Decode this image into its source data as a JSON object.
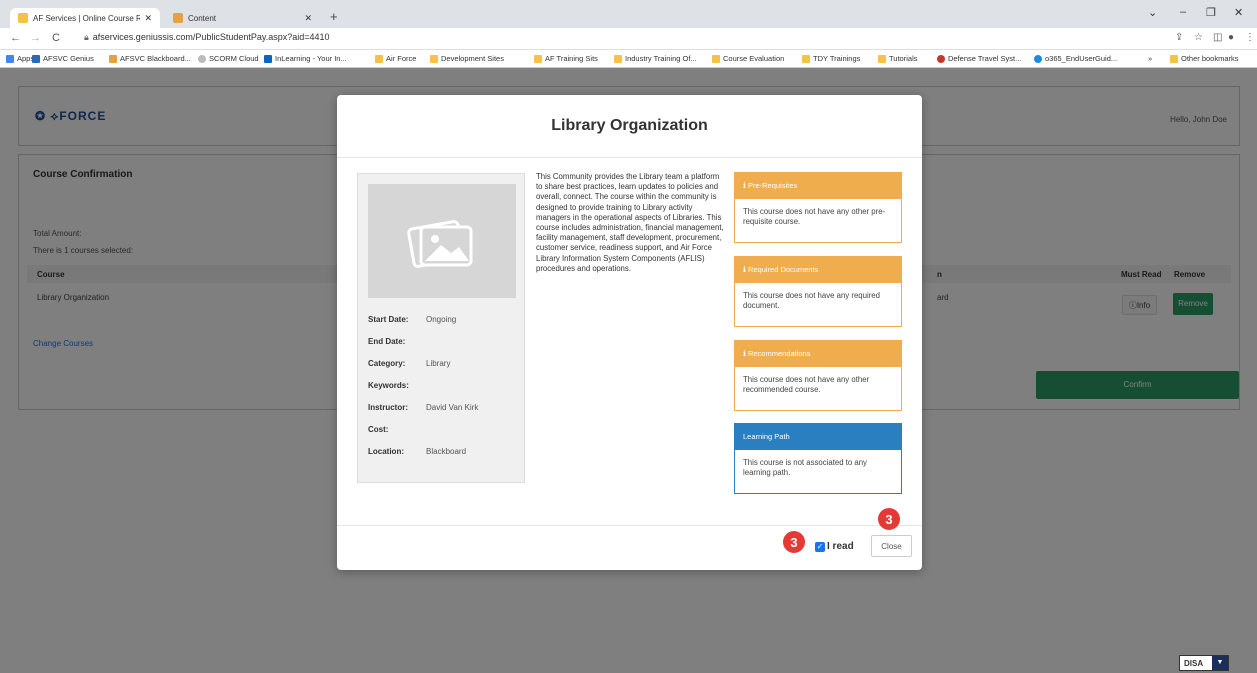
{
  "browser": {
    "tabs": [
      {
        "title": "AF Services | Online Course Regi",
        "close": "✕"
      },
      {
        "title": "Content",
        "close": "✕"
      }
    ],
    "url": "afservices.geniussis.com/PublicStudentPay.aspx?aid=4410",
    "bookmarks": [
      "Apps",
      "AFSVC Genius",
      "AFSVC Blackboard...",
      "SCORM Cloud",
      "InLearning - Your In...",
      "Air Force",
      "Development Sites",
      "AF Training Sits",
      "Industry Training Of...",
      "Course Evaluation",
      "TDY Trainings",
      "Tutorials",
      "Defense Travel Syst...",
      "o365_EndUserGuid...",
      "»",
      "Other bookmarks"
    ]
  },
  "page": {
    "logo": "FORCE",
    "greeting": "Hello, John Doe",
    "section_title": "Course Confirmation",
    "total_amount_label": "Total Amount:",
    "selected_text": "There is 1 courses selected:",
    "table_headers": {
      "course": "Course",
      "n": "n",
      "must_read": "Must Read",
      "remove": "Remove"
    },
    "row": {
      "course": "Library Organization",
      "partial": "ard",
      "info": "Info",
      "remove": "Remove"
    },
    "change_courses": "Change Courses",
    "confirm": "Confirm"
  },
  "modal": {
    "title": "Library Organization",
    "description": "This Community provides the Library team a platform to share best practices, learn updates to policies and overall, connect. The course within the community is designed to provide training to Library activity managers in the operational aspects of Libraries. This course includes administration, financial management, facility management, staff development, procurement, customer service, readiness support, and Air Force Library Information System Components (AFLIS) procedures and operations.",
    "meta": [
      {
        "key": "Start Date:",
        "value": "Ongoing"
      },
      {
        "key": "End Date:",
        "value": ""
      },
      {
        "key": "Category:",
        "value": "Library"
      },
      {
        "key": "Keywords:",
        "value": ""
      },
      {
        "key": "Instructor:",
        "value": "David Van Kirk"
      },
      {
        "key": "Cost:",
        "value": ""
      },
      {
        "key": "Location:",
        "value": "Blackboard"
      }
    ],
    "panels": [
      {
        "title": "Pre-Requisites",
        "body": "This course does not have any other pre-requisite course."
      },
      {
        "title": "Required Documents",
        "body": "This course does not have any required document."
      },
      {
        "title": "Recommendations",
        "body": "This course does not have any other recommended course."
      },
      {
        "title": "Learning Path",
        "body": "This course is not associated to any learning path."
      }
    ],
    "i_read": "I read",
    "close": "Close",
    "badges": [
      "3",
      "3"
    ]
  },
  "footer_badge": "DISA"
}
